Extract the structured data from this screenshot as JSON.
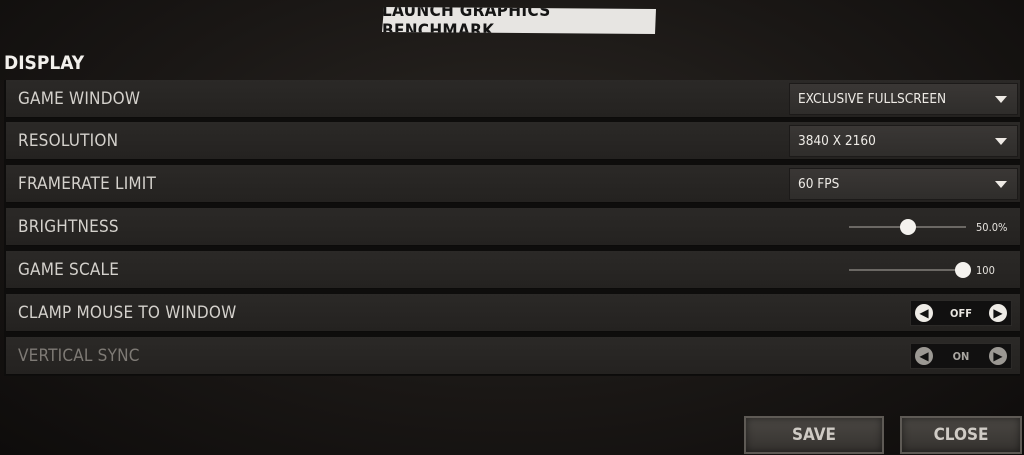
{
  "header": {
    "benchmark_label": "LAUNCH GRAPHICS BENCHMARK"
  },
  "section": {
    "title": "DISPLAY"
  },
  "settings": {
    "game_window": {
      "label": "GAME WINDOW",
      "value": "EXCLUSIVE FULLSCREEN"
    },
    "resolution": {
      "label": "RESOLUTION",
      "value": "3840 X 2160"
    },
    "framerate_limit": {
      "label": "FRAMERATE LIMIT",
      "value": "60 FPS"
    },
    "brightness": {
      "label": "BRIGHTNESS",
      "value_text": "50.0%",
      "fraction": 0.5
    },
    "game_scale": {
      "label": "GAME SCALE",
      "value_text": "100",
      "fraction": 1.0
    },
    "clamp_mouse": {
      "label": "CLAMP MOUSE TO WINDOW",
      "state": "OFF"
    },
    "vertical_sync": {
      "label": "VERTICAL SYNC",
      "state": "ON"
    }
  },
  "footer": {
    "save_label": "SAVE",
    "close_label": "CLOSE"
  }
}
